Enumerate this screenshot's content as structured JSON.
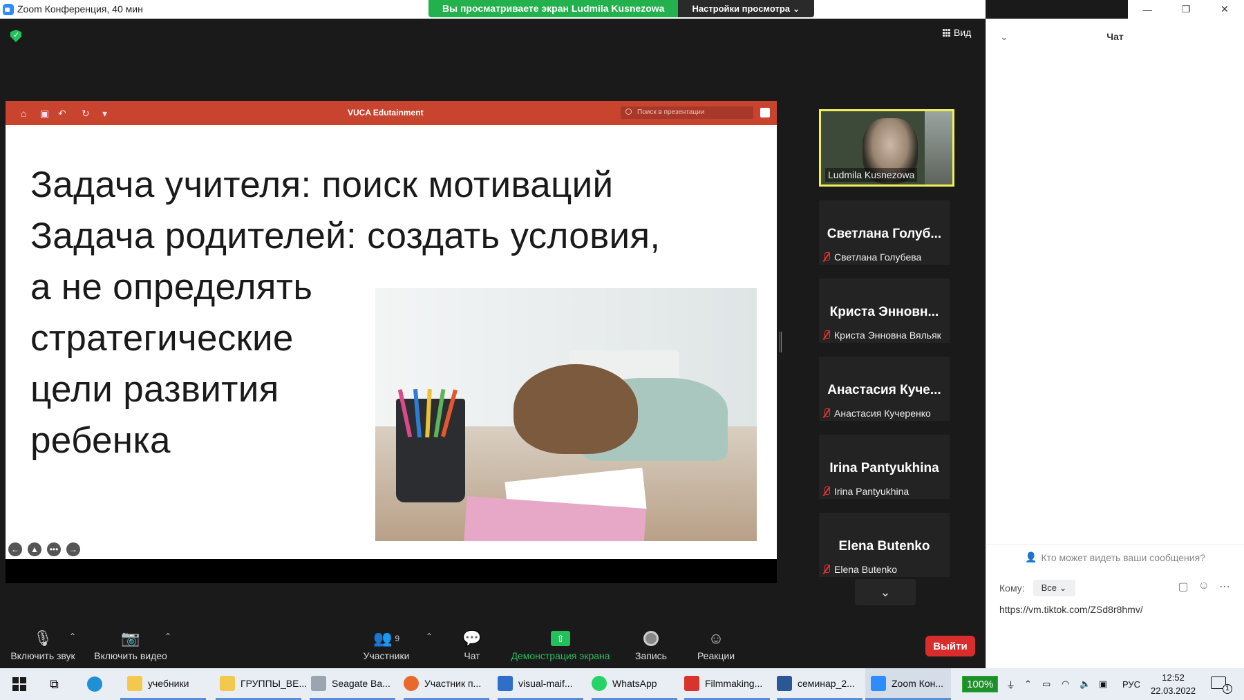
{
  "window": {
    "title": "Zoom Конференция, 40 мин",
    "share_banner": "Вы просматриваете экран Ludmila Kusnezowa",
    "view_options": "Настройки просмотра ⌄",
    "controls": [
      "—",
      "❐",
      "✕"
    ]
  },
  "top_right": {
    "view_label": "Вид"
  },
  "presentation": {
    "doc_title": "VUCA Edutainment",
    "search_placeholder": "Поиск в презентации",
    "lines": [
      "Задача учителя: поиск мотиваций",
      "Задача родителей: создать условия,",
      "а не определять",
      "стратегические",
      "цели развития",
      "ребенка"
    ],
    "nav": [
      "←",
      "▲",
      "•••",
      "→"
    ]
  },
  "participants": {
    "active": {
      "name": "Ludmila Kusnezowa"
    },
    "tiles": [
      {
        "big": "Светлана Голуб...",
        "name": "Светлана Голубева"
      },
      {
        "big": "Криста Энновн...",
        "name": "Криста Энновна Вяльяк"
      },
      {
        "big": "Анастасия Куче...",
        "name": "Анастасия Кучеренко"
      },
      {
        "big": "Irina Pantyukhina",
        "name": "Irina Pantyukhina"
      },
      {
        "big": "Elena Butenko",
        "name": "Elena Butenko"
      }
    ],
    "more": "⌄"
  },
  "toolbar": {
    "unmute": "Включить звук",
    "start_video": "Включить видео",
    "participants": "Участники",
    "participants_count": "9",
    "chat": "Чат",
    "share": "Демонстрация экрана",
    "record": "Запись",
    "reactions": "Реакции",
    "leave": "Выйти"
  },
  "chat": {
    "title": "Чат",
    "who_can_see": "Кто может видеть ваши сообщения?",
    "to_label": "Кому:",
    "to_value": "Все",
    "draft": "https://vm.tiktok.com/ZSd8r8hmv/"
  },
  "taskbar": {
    "apps": [
      {
        "label": "учебники",
        "color": "#f2c94c"
      },
      {
        "label": "ГРУППЫ_ВЕ...",
        "color": "#f2c94c"
      },
      {
        "label": "Seagate Ba...",
        "color": "#9aa5b1"
      },
      {
        "label": "Участник п...",
        "color": "#e8692b"
      },
      {
        "label": "visual-maif...",
        "color": "#2f6fc9"
      },
      {
        "label": "WhatsApp",
        "color": "#25d366"
      },
      {
        "label": "Filmmaking...",
        "color": "#d9342b"
      },
      {
        "label": "семинар_2...",
        "color": "#2b5797"
      },
      {
        "label": "Zoom Кон...",
        "color": "#2d8cff"
      }
    ],
    "battery": "100%",
    "lang": "РУС",
    "time": "12:52",
    "date": "22.03.2022",
    "notifications": "1"
  }
}
